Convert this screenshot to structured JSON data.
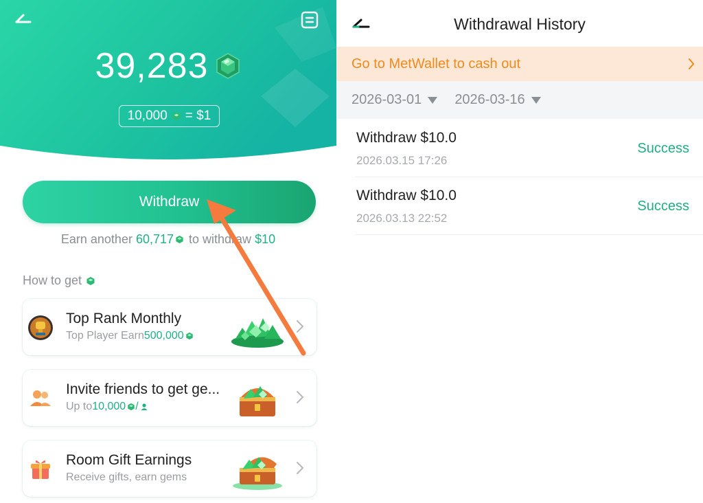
{
  "colors": {
    "brand_green": "#21c08f",
    "banner_bg": "#fde8d7",
    "banner_text": "#f08a1c",
    "success": "#20b07e",
    "arrow": "#f47a3d"
  },
  "wallet": {
    "balance": "39,283",
    "rate_left": "10,000",
    "rate_right": "= $1",
    "withdraw_label": "Withdraw",
    "earn_prefix": "Earn another ",
    "earn_amount": "60,717",
    "earn_middle": " to withdraw ",
    "earn_target": "$10",
    "howto_label": "How to get",
    "cards": [
      {
        "title": "Top Rank Monthly",
        "sub_prefix": "Top Player Earn ",
        "sub_amount": "500,000",
        "icon": "trophy-avatar-icon",
        "picture": "gem-pile-icon"
      },
      {
        "title": "Invite friends to get ge...",
        "sub_prefix": "Up to ",
        "sub_amount": "10,000",
        "icon": "friends-icon",
        "picture": "treasure-chest-icon"
      },
      {
        "title": "Room Gift Earnings",
        "sub_prefix": "Receive gifts, earn gems",
        "sub_amount": "",
        "icon": "gift-box-icon",
        "picture": "treasure-chest-icon"
      }
    ]
  },
  "history": {
    "title": "Withdrawal History",
    "banner_text": "Go to MetWallet to cash out",
    "date_from": "2026-03-01",
    "date_to": "2026-03-16",
    "records": [
      {
        "title": "Withdraw $10.0",
        "date": "2026.03.15 17:26",
        "status": "Success"
      },
      {
        "title": "Withdraw $10.0",
        "date": "2026.03.13 22:52",
        "status": "Success"
      }
    ]
  }
}
